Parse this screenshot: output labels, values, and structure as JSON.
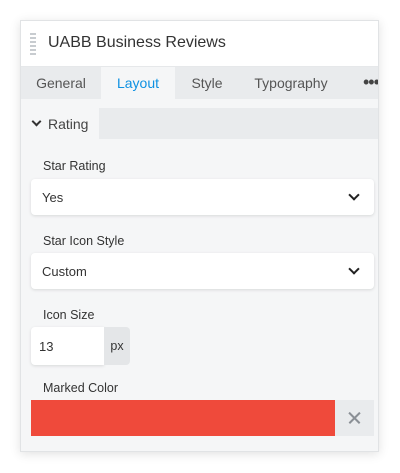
{
  "window": {
    "title": "UABB Business Reviews"
  },
  "tabs": [
    {
      "label": "General",
      "active": false
    },
    {
      "label": "Layout",
      "active": true
    },
    {
      "label": "Style",
      "active": false
    },
    {
      "label": "Typography",
      "active": false
    }
  ],
  "tabs_more_label": "•••",
  "section": {
    "label": "Rating"
  },
  "fields": {
    "star_rating": {
      "label": "Star Rating",
      "value": "Yes"
    },
    "star_icon_style": {
      "label": "Star Icon Style",
      "value": "Custom"
    },
    "icon_size": {
      "label": "Icon Size",
      "value": "13",
      "unit": "px"
    },
    "marked_color": {
      "label": "Marked Color",
      "color": "#ef4a3b"
    }
  },
  "colors": {
    "accent": "#0e91e2",
    "panel_bg": "#f5f6f7",
    "tab_bar_bg": "#e9ebed"
  },
  "icons": {
    "drag": "drag-handle-icon",
    "collapse": "chevron-down-icon",
    "more": "more-horizontal-icon",
    "clear": "close-icon"
  }
}
